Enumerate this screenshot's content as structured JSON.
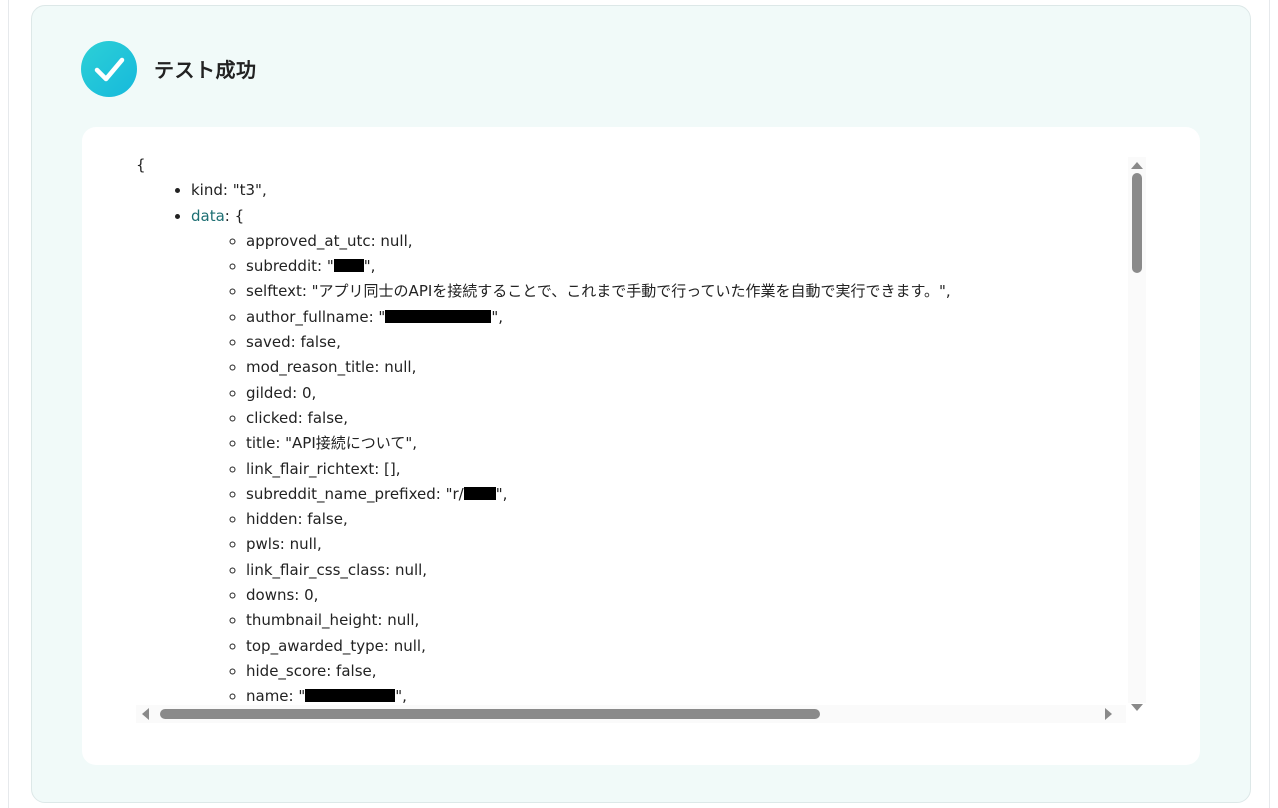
{
  "status": {
    "title": "テスト成功",
    "icon": "check-icon",
    "accent": "#1fc4da"
  },
  "json": {
    "open_brace": "{",
    "top": [
      {
        "key": "kind",
        "value": "\"t3\","
      },
      {
        "key": "data",
        "value": "{"
      }
    ],
    "data_fields": [
      {
        "text": "approved_at_utc: null,"
      },
      {
        "text_before": "subreddit: \"",
        "text_after": "\",",
        "redacted": true,
        "redact_width": 30
      },
      {
        "text": "selftext: \"アプリ同士のAPIを接続することで、これまで手動で行っていた作業を自動で実行できます。\","
      },
      {
        "text_before": "author_fullname: \"",
        "text_after": "\",",
        "redacted": true,
        "redact_width": 106
      },
      {
        "text": "saved: false,"
      },
      {
        "text": "mod_reason_title: null,"
      },
      {
        "text": "gilded: 0,"
      },
      {
        "text": "clicked: false,"
      },
      {
        "text": "title: \"API接続について\","
      },
      {
        "text": "link_flair_richtext: [],"
      },
      {
        "text_before": "subreddit_name_prefixed: \"r/",
        "text_after": "\",",
        "redacted": true,
        "redact_width": 32
      },
      {
        "text": "hidden: false,"
      },
      {
        "text": "pwls: null,"
      },
      {
        "text": "link_flair_css_class: null,"
      },
      {
        "text": "downs: 0,"
      },
      {
        "text": "thumbnail_height: null,"
      },
      {
        "text": "top_awarded_type: null,"
      },
      {
        "text": "hide_score: false,"
      },
      {
        "text_before": "name: \"",
        "text_after": "\",",
        "redacted": true,
        "redact_width": 90
      }
    ]
  }
}
